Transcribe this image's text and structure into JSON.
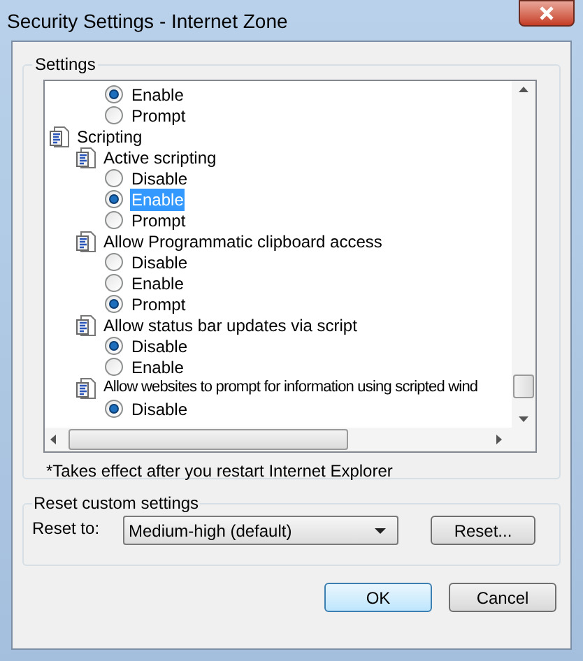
{
  "window": {
    "title": "Security Settings - Internet Zone"
  },
  "settings": {
    "label": "Settings",
    "tree": [
      {
        "options": [
          {
            "label": "Enable",
            "selected": true,
            "highlighted": false
          },
          {
            "label": "Prompt",
            "selected": false,
            "highlighted": false
          }
        ]
      },
      {
        "label": "Scripting",
        "children": [
          {
            "label": "Active scripting",
            "options": [
              {
                "label": "Disable",
                "selected": false,
                "highlighted": false
              },
              {
                "label": "Enable",
                "selected": true,
                "highlighted": true
              },
              {
                "label": "Prompt",
                "selected": false,
                "highlighted": false
              }
            ]
          },
          {
            "label": "Allow Programmatic clipboard access",
            "options": [
              {
                "label": "Disable",
                "selected": false,
                "highlighted": false
              },
              {
                "label": "Enable",
                "selected": false,
                "highlighted": false
              },
              {
                "label": "Prompt",
                "selected": true,
                "highlighted": false
              }
            ]
          },
          {
            "label": "Allow status bar updates via script",
            "options": [
              {
                "label": "Disable",
                "selected": true,
                "highlighted": false
              },
              {
                "label": "Enable",
                "selected": false,
                "highlighted": false
              }
            ]
          },
          {
            "label": "Allow websites to prompt for information using scripted wind",
            "options": [
              {
                "label": "Disable",
                "selected": true,
                "highlighted": false
              }
            ]
          }
        ]
      }
    ],
    "note": "*Takes effect after you restart Internet Explorer"
  },
  "reset": {
    "label": "Reset custom settings",
    "field_label": "Reset to:",
    "value": "Medium-high (default)",
    "button": "Reset..."
  },
  "buttons": [
    "OK",
    "Cancel"
  ]
}
